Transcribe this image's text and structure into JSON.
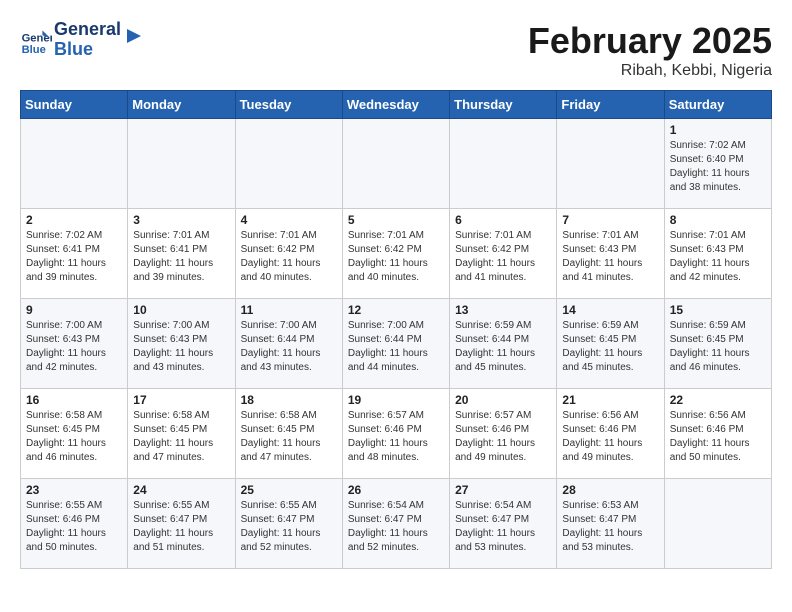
{
  "logo": {
    "line1": "General",
    "line2": "Blue"
  },
  "title": "February 2025",
  "subtitle": "Ribah, Kebbi, Nigeria",
  "weekdays": [
    "Sunday",
    "Monday",
    "Tuesday",
    "Wednesday",
    "Thursday",
    "Friday",
    "Saturday"
  ],
  "weeks": [
    [
      {
        "day": "",
        "info": ""
      },
      {
        "day": "",
        "info": ""
      },
      {
        "day": "",
        "info": ""
      },
      {
        "day": "",
        "info": ""
      },
      {
        "day": "",
        "info": ""
      },
      {
        "day": "",
        "info": ""
      },
      {
        "day": "1",
        "info": "Sunrise: 7:02 AM\nSunset: 6:40 PM\nDaylight: 11 hours and 38 minutes."
      }
    ],
    [
      {
        "day": "2",
        "info": "Sunrise: 7:02 AM\nSunset: 6:41 PM\nDaylight: 11 hours and 39 minutes."
      },
      {
        "day": "3",
        "info": "Sunrise: 7:01 AM\nSunset: 6:41 PM\nDaylight: 11 hours and 39 minutes."
      },
      {
        "day": "4",
        "info": "Sunrise: 7:01 AM\nSunset: 6:42 PM\nDaylight: 11 hours and 40 minutes."
      },
      {
        "day": "5",
        "info": "Sunrise: 7:01 AM\nSunset: 6:42 PM\nDaylight: 11 hours and 40 minutes."
      },
      {
        "day": "6",
        "info": "Sunrise: 7:01 AM\nSunset: 6:42 PM\nDaylight: 11 hours and 41 minutes."
      },
      {
        "day": "7",
        "info": "Sunrise: 7:01 AM\nSunset: 6:43 PM\nDaylight: 11 hours and 41 minutes."
      },
      {
        "day": "8",
        "info": "Sunrise: 7:01 AM\nSunset: 6:43 PM\nDaylight: 11 hours and 42 minutes."
      }
    ],
    [
      {
        "day": "9",
        "info": "Sunrise: 7:00 AM\nSunset: 6:43 PM\nDaylight: 11 hours and 42 minutes."
      },
      {
        "day": "10",
        "info": "Sunrise: 7:00 AM\nSunset: 6:43 PM\nDaylight: 11 hours and 43 minutes."
      },
      {
        "day": "11",
        "info": "Sunrise: 7:00 AM\nSunset: 6:44 PM\nDaylight: 11 hours and 43 minutes."
      },
      {
        "day": "12",
        "info": "Sunrise: 7:00 AM\nSunset: 6:44 PM\nDaylight: 11 hours and 44 minutes."
      },
      {
        "day": "13",
        "info": "Sunrise: 6:59 AM\nSunset: 6:44 PM\nDaylight: 11 hours and 45 minutes."
      },
      {
        "day": "14",
        "info": "Sunrise: 6:59 AM\nSunset: 6:45 PM\nDaylight: 11 hours and 45 minutes."
      },
      {
        "day": "15",
        "info": "Sunrise: 6:59 AM\nSunset: 6:45 PM\nDaylight: 11 hours and 46 minutes."
      }
    ],
    [
      {
        "day": "16",
        "info": "Sunrise: 6:58 AM\nSunset: 6:45 PM\nDaylight: 11 hours and 46 minutes."
      },
      {
        "day": "17",
        "info": "Sunrise: 6:58 AM\nSunset: 6:45 PM\nDaylight: 11 hours and 47 minutes."
      },
      {
        "day": "18",
        "info": "Sunrise: 6:58 AM\nSunset: 6:45 PM\nDaylight: 11 hours and 47 minutes."
      },
      {
        "day": "19",
        "info": "Sunrise: 6:57 AM\nSunset: 6:46 PM\nDaylight: 11 hours and 48 minutes."
      },
      {
        "day": "20",
        "info": "Sunrise: 6:57 AM\nSunset: 6:46 PM\nDaylight: 11 hours and 49 minutes."
      },
      {
        "day": "21",
        "info": "Sunrise: 6:56 AM\nSunset: 6:46 PM\nDaylight: 11 hours and 49 minutes."
      },
      {
        "day": "22",
        "info": "Sunrise: 6:56 AM\nSunset: 6:46 PM\nDaylight: 11 hours and 50 minutes."
      }
    ],
    [
      {
        "day": "23",
        "info": "Sunrise: 6:55 AM\nSunset: 6:46 PM\nDaylight: 11 hours and 50 minutes."
      },
      {
        "day": "24",
        "info": "Sunrise: 6:55 AM\nSunset: 6:47 PM\nDaylight: 11 hours and 51 minutes."
      },
      {
        "day": "25",
        "info": "Sunrise: 6:55 AM\nSunset: 6:47 PM\nDaylight: 11 hours and 52 minutes."
      },
      {
        "day": "26",
        "info": "Sunrise: 6:54 AM\nSunset: 6:47 PM\nDaylight: 11 hours and 52 minutes."
      },
      {
        "day": "27",
        "info": "Sunrise: 6:54 AM\nSunset: 6:47 PM\nDaylight: 11 hours and 53 minutes."
      },
      {
        "day": "28",
        "info": "Sunrise: 6:53 AM\nSunset: 6:47 PM\nDaylight: 11 hours and 53 minutes."
      },
      {
        "day": "",
        "info": ""
      }
    ]
  ]
}
